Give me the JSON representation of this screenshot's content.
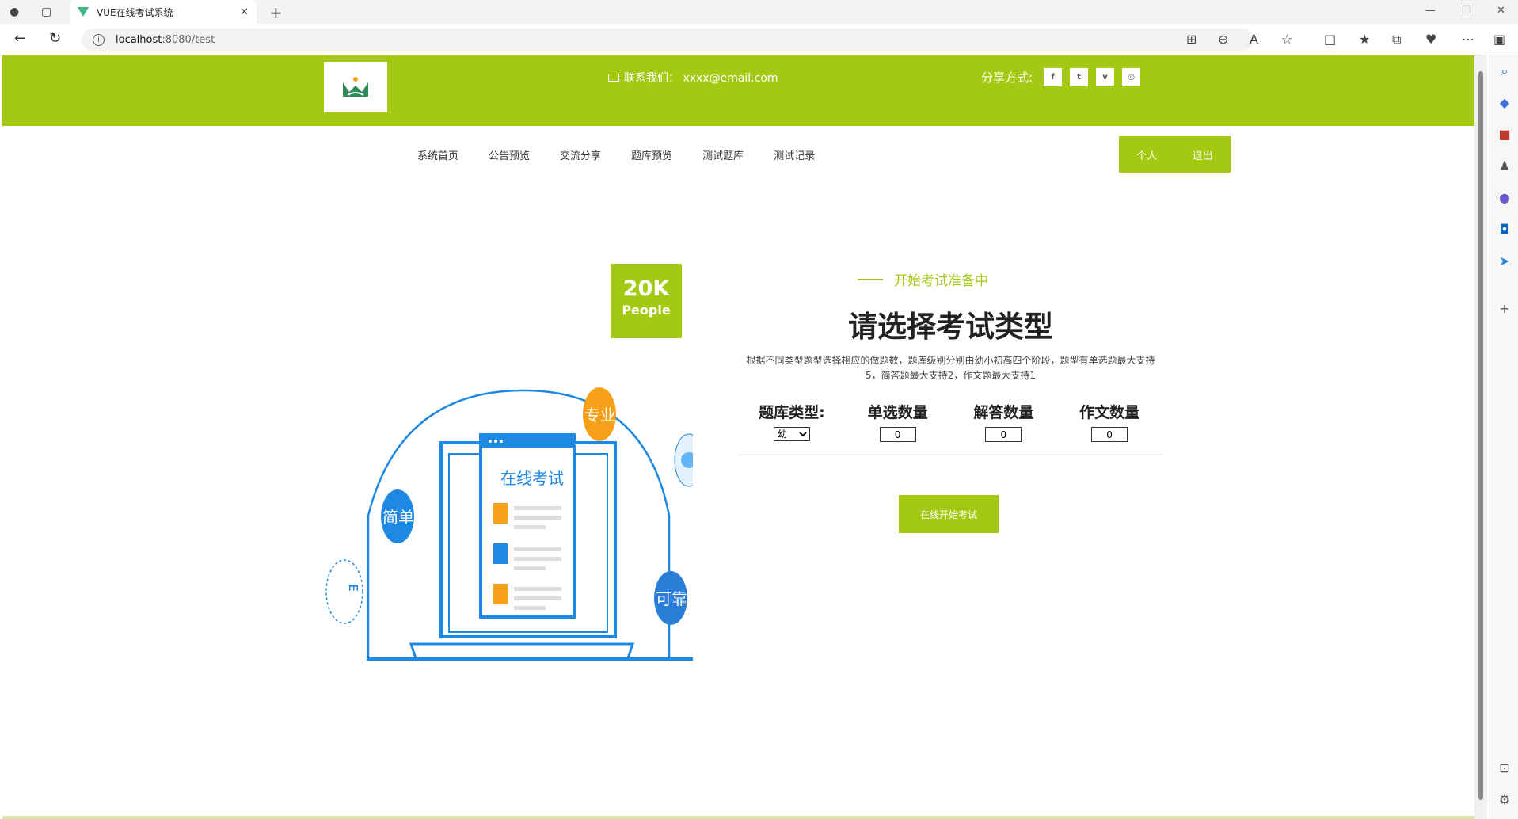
{
  "browser": {
    "tab_title": "VUE在线考试系统",
    "url_host": "localhost",
    "url_rest": ":8080/test"
  },
  "header": {
    "contact_text": "联系我们： xxxx@email.com",
    "share_label": "分享方式:",
    "social": [
      "f",
      "t",
      "v",
      "◎"
    ]
  },
  "nav": {
    "items": [
      "系统首页",
      "公告预览",
      "交流分享",
      "题库预览",
      "测试题库",
      "测试记录"
    ],
    "personal": "个人",
    "logout": "退出"
  },
  "badge": {
    "big": "20K",
    "small": "People"
  },
  "illustration": {
    "screen_title": "在线考试",
    "tag_pro": "专业",
    "tag_simple": "简单",
    "tag_reliable": "可靠"
  },
  "exam": {
    "subtitle": "开始考试准备中",
    "title": "请选择考试类型",
    "description": "根据不同类型题型选择相应的做题数，题库级别分别由幼小初高四个阶段，题型有单选题最大支持5，简答题最大支持2，作文题最大支持1",
    "fields": {
      "type_label": "题库类型:",
      "type_value": "幼",
      "single_label": "单选数量",
      "single_value": "0",
      "answer_label": "解答数量",
      "answer_value": "0",
      "essay_label": "作文数量",
      "essay_value": "0"
    },
    "start_button": "在线开始考试"
  },
  "colors": {
    "brand": "#a4c912",
    "blue": "#1e88e5",
    "orange": "#f7a11a"
  }
}
